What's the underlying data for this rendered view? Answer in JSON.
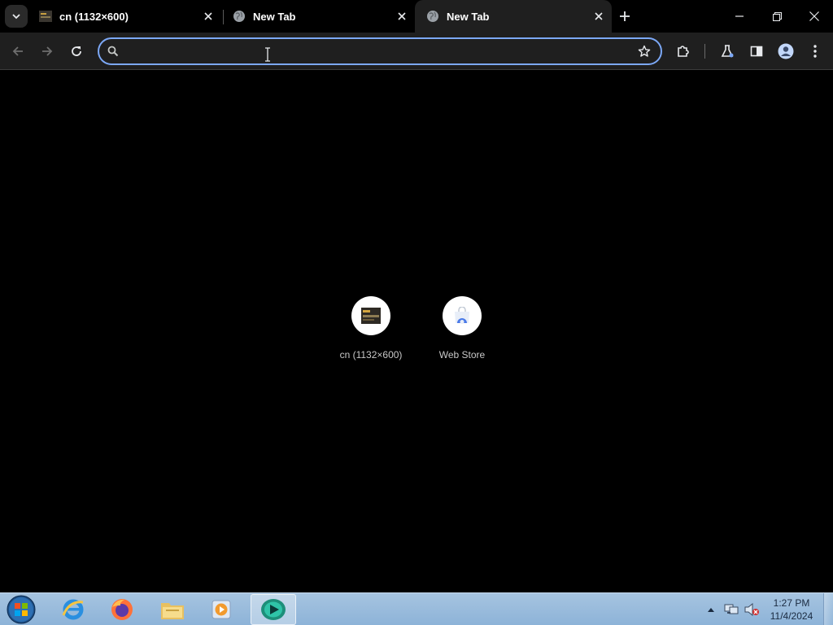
{
  "browser": {
    "tabs": [
      {
        "title": "cn (1132×600)",
        "active": false
      },
      {
        "title": "New Tab",
        "active": false
      },
      {
        "title": "New Tab",
        "active": true
      }
    ],
    "omnibox": {
      "value": "",
      "placeholder": ""
    },
    "colors": {
      "omnibox_focus": "#7ca8f6",
      "toolbar_bg": "#1f1f1f",
      "page_bg": "#000000"
    }
  },
  "new_tab_page": {
    "shortcuts": [
      {
        "label": "cn (1132×600)",
        "icon": "cn-thumbnail-icon"
      },
      {
        "label": "Web Store",
        "icon": "web-store-icon"
      }
    ]
  },
  "taskbar": {
    "apps": [
      "start-orb-icon",
      "internet-explorer-icon",
      "firefox-icon",
      "file-explorer-icon",
      "media-player-icon",
      "active-app-icon"
    ],
    "clock": {
      "time": "1:27 PM",
      "date": "11/4/2024"
    }
  }
}
